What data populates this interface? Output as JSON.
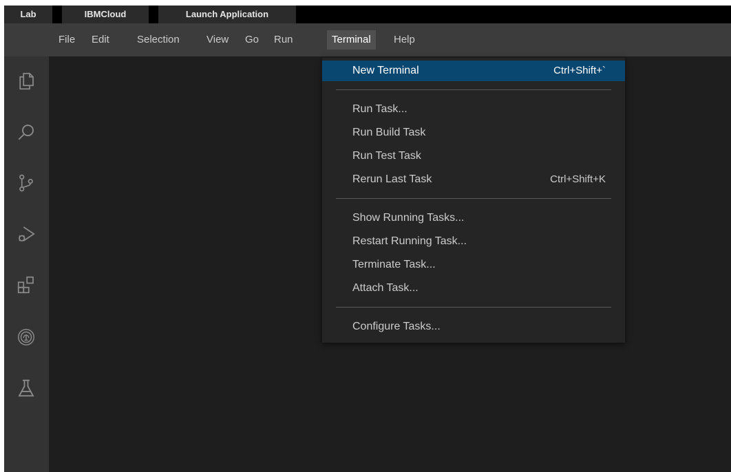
{
  "tabs": [
    "Lab",
    "IBMCloud",
    "Launch Application"
  ],
  "menubar": {
    "items": [
      "File",
      "Edit",
      "Selection",
      "View",
      "Go",
      "Run",
      "Terminal",
      "Help"
    ],
    "active": "Terminal"
  },
  "activitybar": {
    "icons": [
      "explorer-icon",
      "search-icon",
      "source-control-icon",
      "run-debug-icon",
      "extensions-icon",
      "ibm-cloud-icon",
      "lab-flask-icon"
    ]
  },
  "terminal_menu": {
    "items": [
      {
        "label": "New Terminal",
        "shortcut": "Ctrl+Shift+`"
      },
      {
        "label": "Run Task..."
      },
      {
        "label": "Run Build Task"
      },
      {
        "label": "Run Test Task"
      },
      {
        "label": "Rerun Last Task",
        "shortcut": "Ctrl+Shift+K"
      },
      {
        "label": "Show Running Tasks..."
      },
      {
        "label": "Restart Running Task..."
      },
      {
        "label": "Terminate Task..."
      },
      {
        "label": "Attach Task..."
      },
      {
        "label": "Configure Tasks..."
      }
    ]
  },
  "colors": {
    "menu_highlight": "#094771",
    "editor_bg": "#1e1e1e",
    "menubar_bg": "#3c3c3c",
    "activitybar_bg": "#333333",
    "dropdown_bg": "#252526"
  }
}
